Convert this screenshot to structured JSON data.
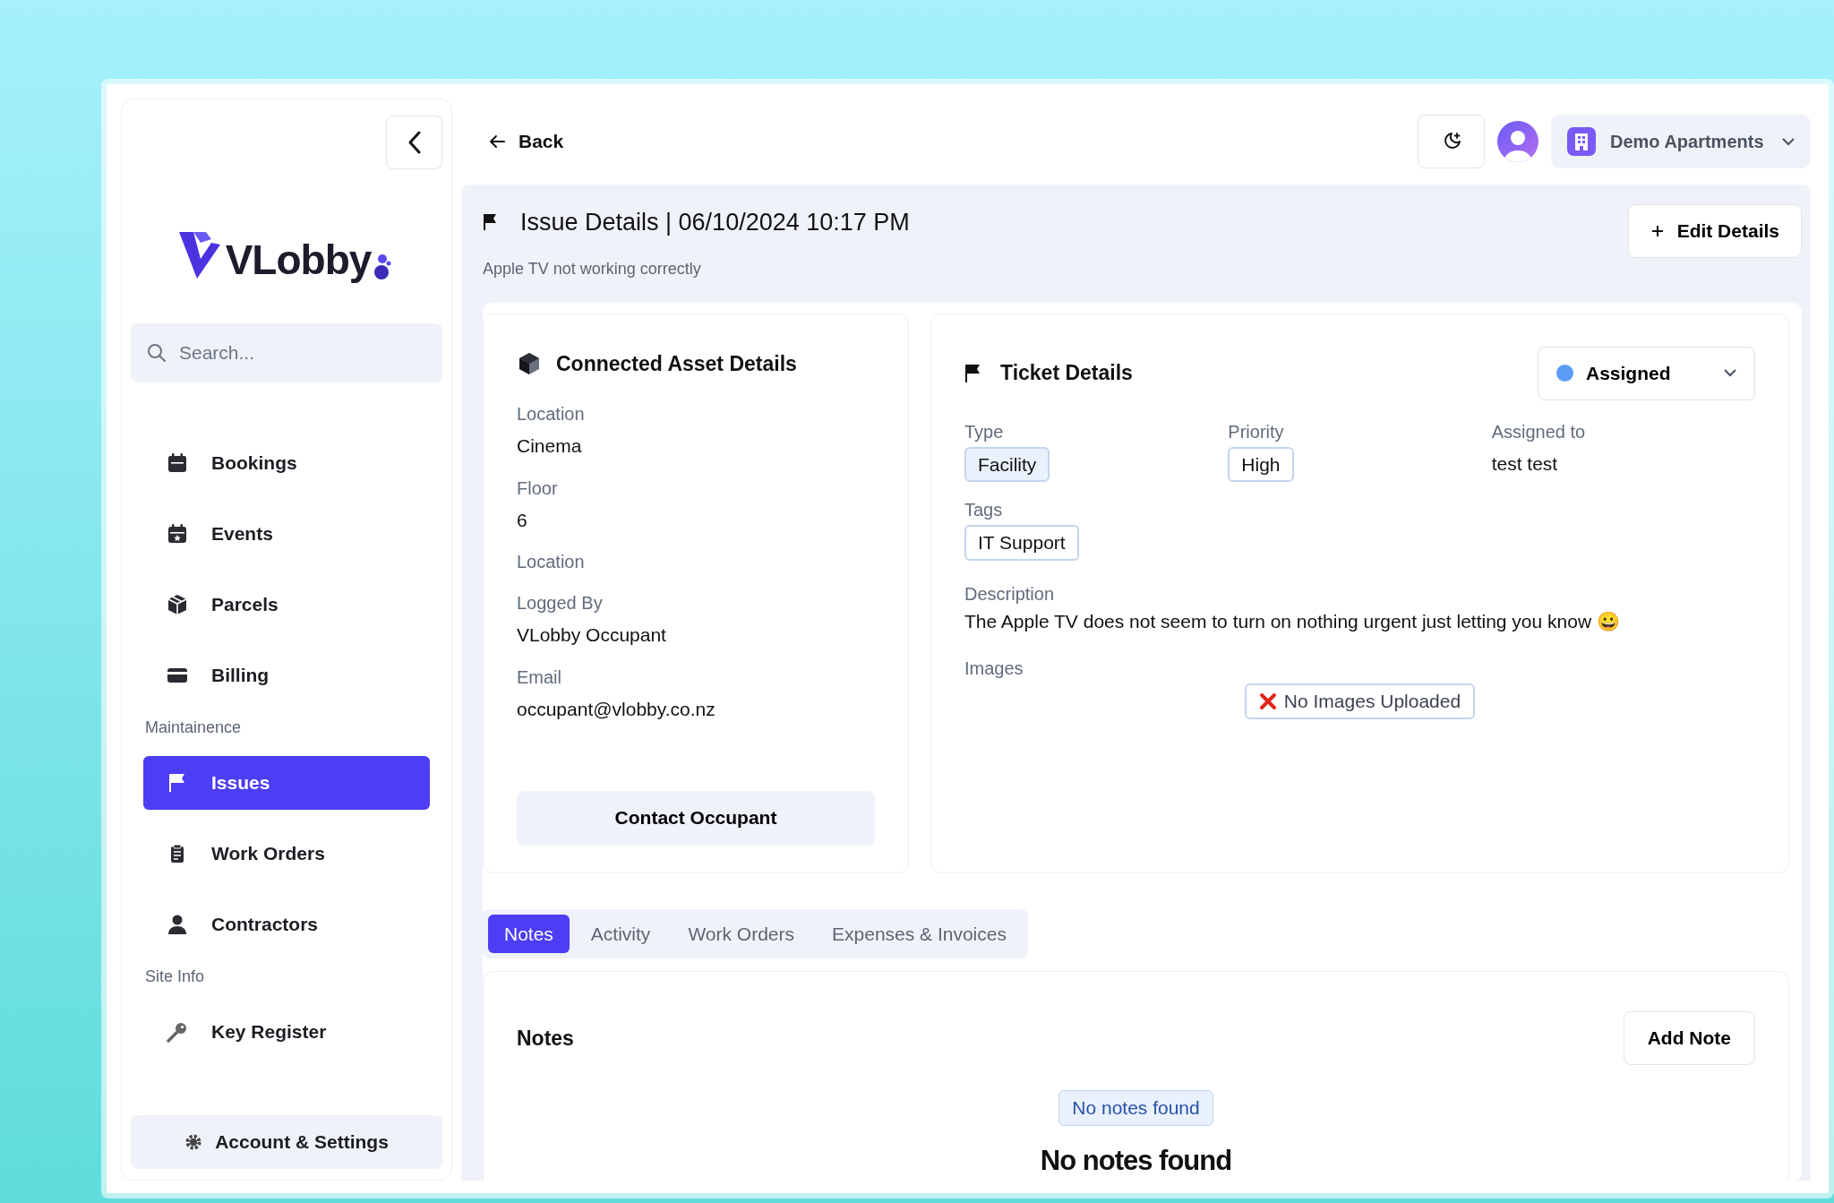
{
  "sidebar": {
    "logo": "VLobby",
    "search": {
      "placeholder": "Search..."
    },
    "sections": [
      {
        "items": [
          {
            "label": "Bookings",
            "selected": false
          },
          {
            "label": "Events",
            "selected": false
          },
          {
            "label": "Parcels",
            "selected": false
          },
          {
            "label": "Billing",
            "selected": false
          }
        ]
      },
      {
        "heading": "Maintainence",
        "items": [
          {
            "label": "Issues",
            "selected": true
          },
          {
            "label": "Work Orders",
            "selected": false
          },
          {
            "label": "Contractors",
            "selected": false
          }
        ]
      },
      {
        "heading": "Site Info",
        "items": [
          {
            "label": "Key Register",
            "selected": false
          }
        ]
      }
    ],
    "footer_button": "Account & Settings"
  },
  "header": {
    "back": "Back",
    "organization": "Demo Apartments"
  },
  "page": {
    "title": "Issue Details | 06/10/2024 10:17 PM",
    "subtitle": "Apple TV not working correctly",
    "edit_button": "Edit Details"
  },
  "asset_card": {
    "title": "Connected Asset Details",
    "fields": [
      {
        "label": "Location",
        "value": "Cinema"
      },
      {
        "label": "Floor",
        "value": "6"
      },
      {
        "label": "Location"
      },
      {
        "label": "Logged By",
        "value": "VLobby Occupant"
      },
      {
        "label": "Email",
        "value": "occupant@vlobby.co.nz"
      }
    ],
    "button": "Contact Occupant"
  },
  "ticket_card": {
    "title": "Ticket Details",
    "status": {
      "label": "Assigned",
      "color": "#5b9cf6"
    },
    "fields": [
      {
        "label": "Type",
        "value": "Facility",
        "kind": "tinted"
      },
      {
        "label": "Priority",
        "value": "High",
        "kind": "outline"
      },
      {
        "label": "Assigned to",
        "value": "test test",
        "kind": "text"
      }
    ],
    "tags_label": "Tags",
    "tags": [
      "IT Support"
    ],
    "description_label": "Description",
    "description": "The Apple TV does not seem to turn on nothing urgent just letting you know 😀",
    "images_label": "Images",
    "images_empty": "No Images Uploaded"
  },
  "tabs": [
    {
      "label": "Notes",
      "selected": true
    },
    {
      "label": "Activity",
      "selected": false
    },
    {
      "label": "Work Orders",
      "selected": false
    },
    {
      "label": "Expenses & Invoices",
      "selected": false
    }
  ],
  "notes": {
    "title": "Notes",
    "add_button": "Add Note",
    "empty_badge": "No notes found",
    "empty_heading": "No notes found"
  }
}
